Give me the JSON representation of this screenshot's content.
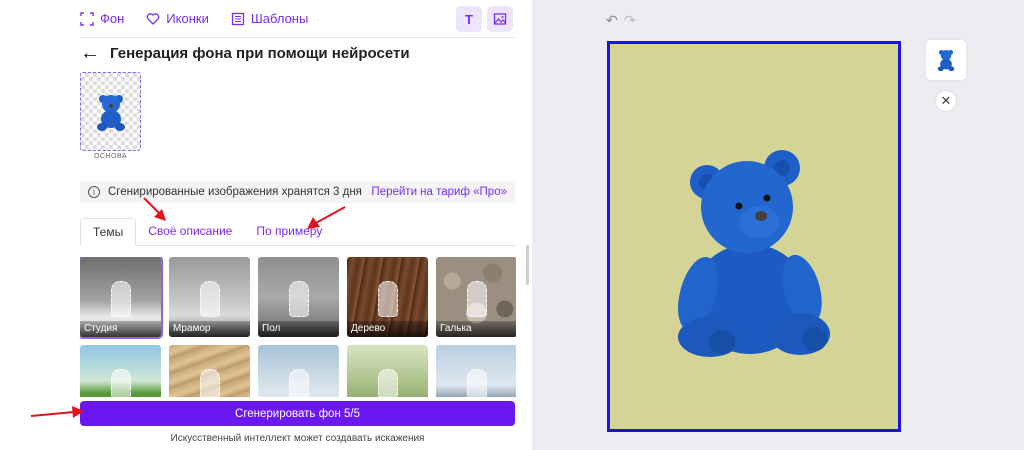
{
  "nav": {
    "background": "Фон",
    "icons": "Иконки",
    "templates": "Шаблоны",
    "text_btn": "T"
  },
  "header": {
    "title": "Генерация фона при помощи нейросети"
  },
  "base": {
    "label": "ОСНОВА"
  },
  "info": {
    "text": "Сгенирированные изображения хранятся 3 дня",
    "link": "Перейти на тариф «Про»"
  },
  "tabs": [
    "Темы",
    "Своё описание",
    "По примеру"
  ],
  "themes": [
    {
      "label": "Студия"
    },
    {
      "label": "Мрамор"
    },
    {
      "label": "Пол"
    },
    {
      "label": "Дерево"
    },
    {
      "label": "Галька"
    },
    {
      "label": ""
    },
    {
      "label": ""
    },
    {
      "label": ""
    },
    {
      "label": ""
    },
    {
      "label": ""
    }
  ],
  "generate": {
    "label": "Сгенерировать фон 5/5"
  },
  "disclaimer": "Искусственный интеллект может создавать искажения",
  "colors": {
    "accent": "#6b18f0",
    "canvas_bg": "#d5d497",
    "canvas_border": "#1a12e8",
    "annotation": "#e0141c"
  }
}
